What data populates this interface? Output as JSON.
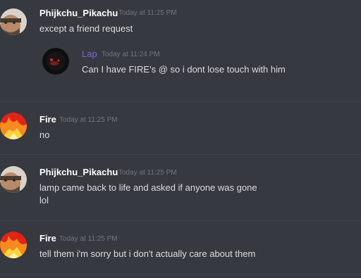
{
  "messages": [
    {
      "author": "Phijkchu_Pikachu",
      "time": "Today at 11:25 PM",
      "lines": [
        "except a friend request"
      ],
      "embed": {
        "author": "Lap",
        "time": "Today at 11:24 PM",
        "text": "Can I have FIRE's @ so i dont lose touch with him"
      }
    },
    {
      "author": "Fire",
      "time": "Today at 11:25 PM",
      "lines": [
        "no"
      ]
    },
    {
      "author": "Phijkchu_Pikachu",
      "time": "Today at 11:25 PM",
      "lines": [
        "lamp came back to life and asked if anyone was gone",
        "lol"
      ]
    },
    {
      "author": "Fire",
      "time": "Today at 11:25 PM",
      "lines": [
        "tell them i'm sorry but i don't actually care about them"
      ]
    }
  ],
  "colors": {
    "background": "#36393f",
    "divider": "#40444b",
    "username": "#ffffff",
    "quoted_username": "#7b68d8",
    "timestamp": "#72767d",
    "text": "#dcddde"
  }
}
